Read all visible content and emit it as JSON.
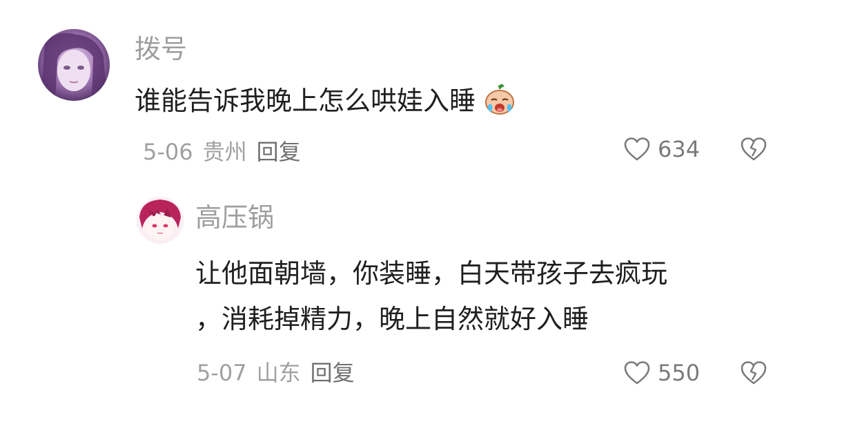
{
  "comment": {
    "username": "拨号",
    "text": "谁能告诉我晚上怎么哄娃入睡",
    "emoji_icon": "crying-baby-emoji-icon",
    "date": "5-06",
    "location": "贵州",
    "reply_label": "回复",
    "like_count": "634"
  },
  "reply": {
    "username": "高压锅",
    "text_line1": "让他面朝墙，你装睡，白天带孩子去疯玩",
    "text_line2": "，消耗掉精力，晚上自然就好入睡",
    "date": "5-07",
    "location": "山东",
    "reply_label": "回复",
    "like_count": "550"
  },
  "icons": {
    "like": "heart-outline-icon",
    "dislike": "broken-heart-icon"
  },
  "colors": {
    "username": "#9e9e9e",
    "text": "#1f1f1f",
    "meta": "#a0a0a0",
    "reply_link": "#6f6f6f"
  }
}
